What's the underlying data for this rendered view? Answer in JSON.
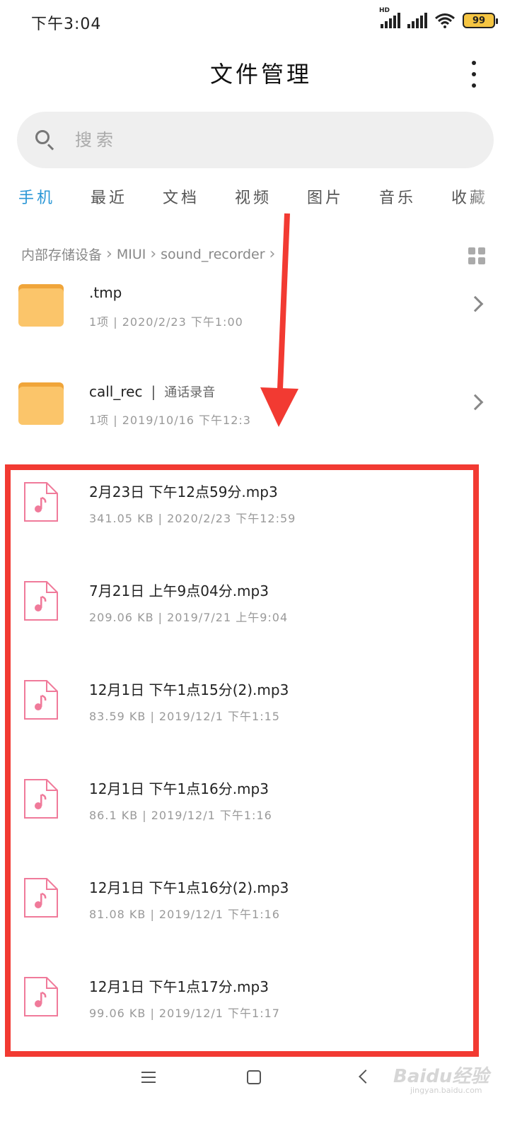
{
  "status_bar": {
    "time": "下午3:04",
    "signal_label": "HD",
    "battery": "99"
  },
  "header": {
    "title": "文件管理"
  },
  "search": {
    "placeholder": "搜索"
  },
  "tabs": [
    {
      "label": "手机",
      "active": true
    },
    {
      "label": "最近"
    },
    {
      "label": "文档"
    },
    {
      "label": "视频"
    },
    {
      "label": "图片"
    },
    {
      "label": "音乐"
    },
    {
      "label": "收藏"
    }
  ],
  "breadcrumb": [
    "内部存储设备",
    "MIUI",
    "sound_recorder"
  ],
  "folders": [
    {
      "name": ".tmp",
      "meta": "1项 | 2020/2/23 下午1:00"
    },
    {
      "name": "call_rec",
      "tag": "通话录音",
      "meta": "1项 | 2019/10/16 下午12:3"
    }
  ],
  "files": [
    {
      "name": "2月23日 下午12点59分.mp3",
      "meta": "341.05 KB | 2020/2/23 下午12:59"
    },
    {
      "name": "7月21日 上午9点04分.mp3",
      "meta": "209.06 KB | 2019/7/21 上午9:04"
    },
    {
      "name": "12月1日 下午1点15分(2).mp3",
      "meta": "83.59 KB | 2019/12/1 下午1:15"
    },
    {
      "name": "12月1日 下午1点16分.mp3",
      "meta": "86.1 KB | 2019/12/1 下午1:16"
    },
    {
      "name": "12月1日 下午1点16分(2).mp3",
      "meta": "81.08 KB | 2019/12/1 下午1:16"
    },
    {
      "name": "12月1日 下午1点17分.mp3",
      "meta": "99.06 KB | 2019/12/1 下午1:17"
    }
  ],
  "colors": {
    "accent": "#2a97d6",
    "annotation": "#f23a32",
    "folder": "#fbc56a",
    "audio_icon": "#f07a9a"
  },
  "watermark": {
    "brand": "Baidu经验",
    "site": "jingyan.baidu.com"
  }
}
